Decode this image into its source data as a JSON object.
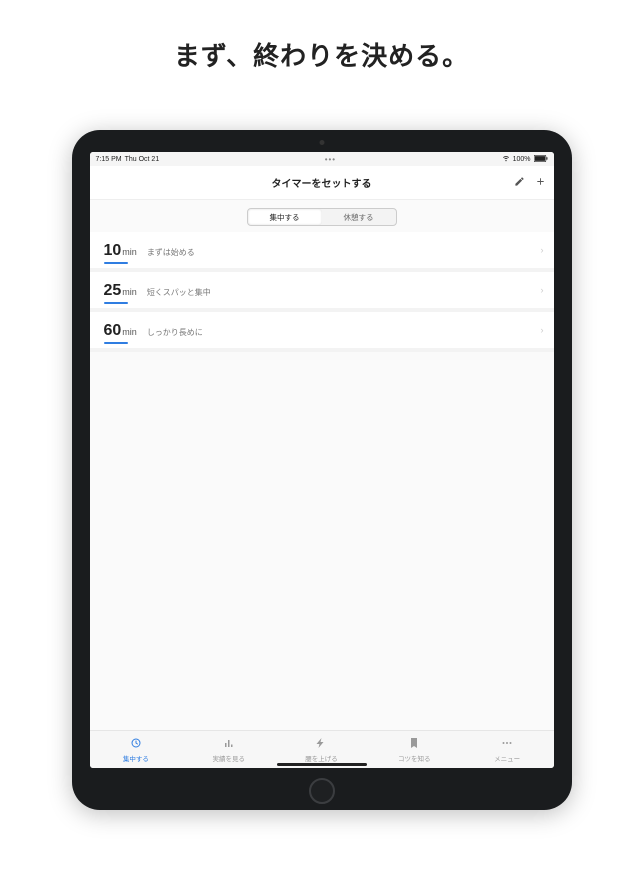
{
  "headline": "まず、終わりを決める。",
  "status": {
    "time": "7:15 PM",
    "date": "Thu Oct 21",
    "more": "•••",
    "wifi": "wifi-icon",
    "battery_pct": "100%"
  },
  "nav": {
    "title": "タイマーをセットする",
    "edit_icon": "pencil-icon",
    "add_icon": "plus-icon"
  },
  "segments": {
    "focus": "集中する",
    "break": "休憩する",
    "active": "focus"
  },
  "presets": [
    {
      "value": "10",
      "unit": "min",
      "label": "まずは始める"
    },
    {
      "value": "25",
      "unit": "min",
      "label": "短くスパッと集中"
    },
    {
      "value": "60",
      "unit": "min",
      "label": "しっかり長めに"
    }
  ],
  "tabs": [
    {
      "label": "集中する",
      "icon": "clock-icon",
      "active": true
    },
    {
      "label": "実績を見る",
      "icon": "bar-chart-icon",
      "active": false
    },
    {
      "label": "腰を上げる",
      "icon": "bolt-icon",
      "active": false
    },
    {
      "label": "コツを知る",
      "icon": "bookmark-icon",
      "active": false
    },
    {
      "label": "メニュー",
      "icon": "ellipsis-icon",
      "active": false
    }
  ],
  "colors": {
    "accent": "#2f7de1"
  }
}
